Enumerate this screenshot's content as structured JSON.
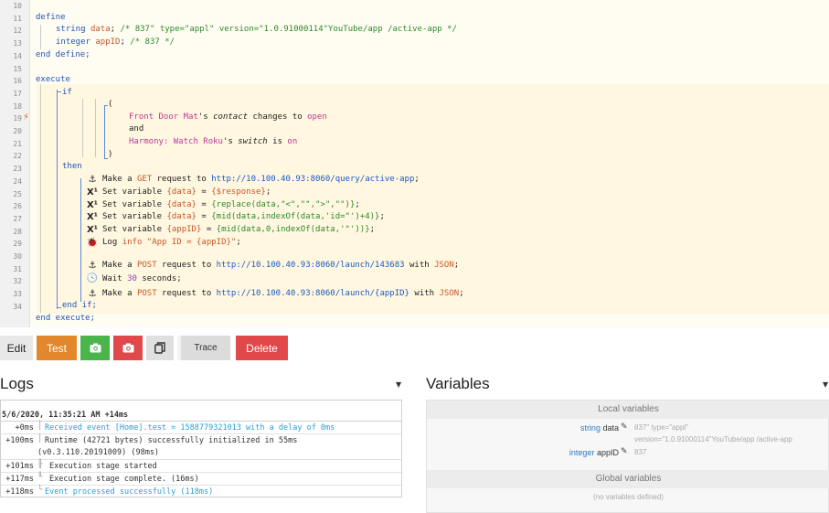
{
  "code": {
    "line_numbers": [
      "10",
      "11",
      "12",
      "13",
      "14",
      "15",
      "16",
      "17",
      "18",
      "19",
      "20",
      "21",
      "22",
      "23",
      "24",
      "25",
      "26",
      "27",
      "28",
      "29",
      "30",
      "31",
      "32",
      "33",
      "34"
    ],
    "define": "define",
    "line11_type": "string",
    "line11_var": "data",
    "line11_comment": "/* 837\" type=\"appl\" version=\"1.0.91000114\"YouTube/app /active-app */",
    "line12_type": "integer",
    "line12_var": "appID",
    "line12_comment": "/* 837 */",
    "end_define": "end define;",
    "execute": "execute",
    "if": "if",
    "open_paren": "(",
    "cond1_device": "Front Door Mat",
    "cond1_possessive": "'s",
    "cond1_attr": "contact",
    "cond1_verb": "changes to",
    "cond1_value": "open",
    "and": "and",
    "cond2_device": "Harmony: Watch Roku",
    "cond2_possessive": "'s",
    "cond2_attr": "switch",
    "cond2_verb": "is",
    "cond2_value": "on",
    "close_paren": ")",
    "then": "then",
    "s1_pre": "Make a",
    "s1_method": "GET",
    "s1_mid": "request to",
    "s1_url": "http://10.100.40.93:8060/query/active-app",
    "s1_end": ";",
    "s2_pre": "Set variable",
    "s2_var": "{data}",
    "s2_eq": "=",
    "s2_val": "{$response}",
    "s2_end": ";",
    "s3_pre": "Set variable",
    "s3_var": "{data}",
    "s3_eq": "=",
    "s3_val": "{replace(data,\"<\",\"\",\">\",\"\")}",
    "s3_end": ";",
    "s4_pre": "Set variable",
    "s4_var": "{data}",
    "s4_eq": "=",
    "s4_val": "{mid(data,indexOf(data,'id=\"')+4)}",
    "s4_end": ";",
    "s5_pre": "Set variable",
    "s5_var": "{appID}",
    "s5_eq": "=",
    "s5_val": "{mid(data,0,indexOf(data,'\"'))}",
    "s5_end": ";",
    "s6_pre": "Log",
    "s6_level": "info",
    "s6_msg": "\"App ID = {appID}\"",
    "s6_end": ";",
    "s7_pre": "Make a",
    "s7_method": "POST",
    "s7_mid": "request to",
    "s7_url": "http://10.100.40.93:8060/launch/143683",
    "s7_with": "with",
    "s7_fmt": "JSON",
    "s7_end": ";",
    "s8_pre": "Wait",
    "s8_num": "30",
    "s8_unit": "seconds;",
    "s9_pre": "Make a",
    "s9_method": "POST",
    "s9_mid": "request to",
    "s9_url": "http://10.100.40.93:8060/launch/{appID}",
    "s9_with": "with",
    "s9_fmt": "JSON",
    "s9_end": ";",
    "end_if": "end if;",
    "end_execute": "end execute;"
  },
  "toolbar": {
    "edit": "Edit",
    "test": "Test",
    "trace": "Trace",
    "delete": "Delete"
  },
  "logs": {
    "title": "Logs",
    "header": "5/6/2020, 11:35:21 AM +14ms",
    "rows": [
      {
        "time": "+0ms",
        "msg": "Received event [Home].test = 1588779321013 with a delay of 0ms"
      },
      {
        "time": "+100ms",
        "msg": "Runtime (42721 bytes) successfully initialized in 55ms",
        "msg2": "(v0.3.110.20191009) (98ms)"
      },
      {
        "time": "+101ms",
        "msg": "Execution stage started"
      },
      {
        "time": "+117ms",
        "msg": "Execution stage complete. (16ms)"
      },
      {
        "time": "+118ms",
        "msg": "Event processed successfully (118ms)"
      }
    ]
  },
  "variables": {
    "title": "Variables",
    "local_header": "Local variables",
    "local": [
      {
        "type": "string",
        "name": "data",
        "value1": "837\" type=\"appl\"",
        "value2": "version=\"1.0.91000114\"YouTube/app /active-app"
      },
      {
        "type": "integer",
        "name": "appID",
        "value1": "837"
      }
    ],
    "global_header": "Global variables",
    "global_empty": "(no variables defined)"
  }
}
